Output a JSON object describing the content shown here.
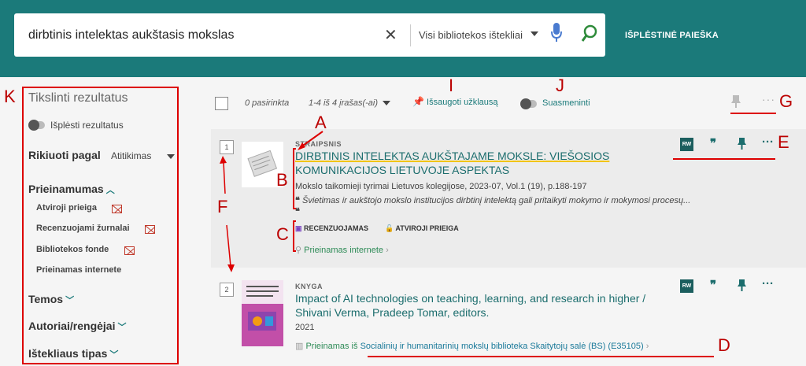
{
  "search": {
    "query": "dirbtinis intelektas aukštasis mokslas",
    "scope": "Visi bibliotekos ištekliai",
    "advanced_label": "IŠPLĖSTINĖ PAIEŠKA"
  },
  "sidebar": {
    "title": "Tikslinti rezultatus",
    "expand_label": "Išplėsti rezultatus",
    "sort_label": "Rikiuoti pagal",
    "sort_value": "Atitikimas",
    "availability_head": "Prieinamumas",
    "availability_items": [
      "Atviroji prieiga",
      "Recenzuojami žurnalai",
      "Bibliotekos fonde",
      "Prieinamas internete"
    ],
    "facets": [
      "Temos",
      "Autoriai/rengėjai",
      "Ištekliaus tipas"
    ]
  },
  "toolbar": {
    "selected": "0 pasirinkta",
    "count": "1-4 iš 4 įrašas(-ai)",
    "save_query": "Išsaugoti užklausą",
    "summarize": "Suasmeninti"
  },
  "results": [
    {
      "index": "1",
      "type": "STRAIPSNIS",
      "title_line1": "DIRBTINIS INTELEKTAS AUKŠTAJAME MOKSLE: VIEŠOSIOS",
      "title_line2": "KOMUNIKACIJOS LIETUVOJE ASPEKTAS",
      "source": "Mokslo taikomieji tyrimai Lietuvos kolegijose, 2023-07, Vol.1 (19), p.188-197",
      "snippet": "Švietimas ir aukštojo mokslo institucijos dirbtinį intelektą gali pritaikyti mokymo ir mokymosi procesų...",
      "badge_peer": "RECENZUOJAMAS",
      "badge_open": "ATVIROJI PRIEIGA",
      "availability": "Prieinamas internete"
    },
    {
      "index": "2",
      "type": "KNYGA",
      "title_line1": "Impact of AI technologies on teaching, learning, and research in higher /",
      "title_line2": "Shivani Verma, Pradeep Tomar, editors.",
      "year": "2021",
      "availability_prefix": "Prieinamas iš",
      "availability_location": "Socialinių ir humanitarinių mokslų biblioteka  Skaitytojų salė (BS) (E35105)"
    }
  ],
  "annotations": [
    "A",
    "B",
    "C",
    "D",
    "E",
    "F",
    "G",
    "I",
    "J",
    "K"
  ],
  "colors": {
    "header": "#1b7a7a",
    "accent": "#1b6d6d",
    "annotation": "#d00000",
    "highlight": "#f1c40f",
    "available": "#2e8b57"
  },
  "icons": [
    "clear-icon",
    "dropdown-caret-icon",
    "microphone-icon",
    "search-icon",
    "pin-icon",
    "more-icon",
    "quote-icon",
    "rw-icon",
    "document-icon",
    "book-cover-icon",
    "open-access-icon",
    "peer-review-icon",
    "link-icon",
    "chevron-right-icon",
    "chevron-up-icon",
    "chevron-down-icon"
  ]
}
